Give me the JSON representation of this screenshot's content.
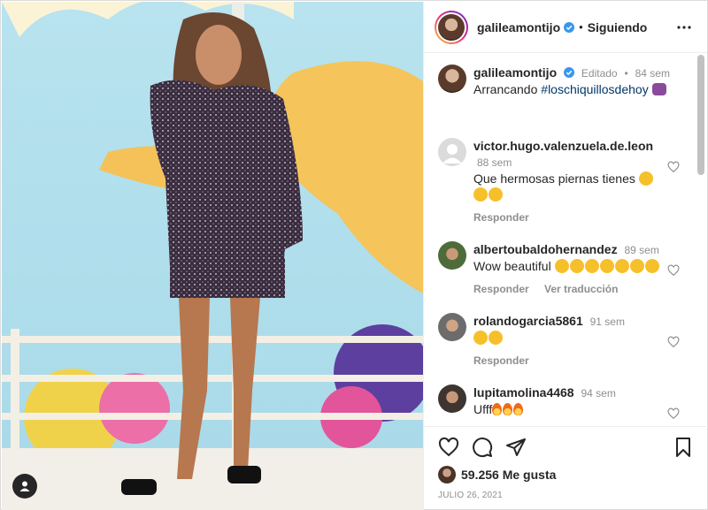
{
  "post": {
    "username": "galileamontijo",
    "separator": "•",
    "follow_status": "Siguiendo"
  },
  "caption": {
    "username": "galileamontijo",
    "edited": "Editado",
    "time": "84 sem",
    "text": "Arrancando",
    "hashtag": "#loschiquillosdehoy"
  },
  "comments": [
    {
      "username": "victor.hugo.valenzuela.de.leon",
      "time": "88 sem",
      "text": "Que hermosas piernas tienes",
      "emoji_count": 3,
      "actions": [
        "Responder"
      ]
    },
    {
      "username": "albertoubaldohernandez",
      "time": "89 sem",
      "text": "Wow beautiful",
      "emoji_count": 7,
      "actions": [
        "Responder",
        "Ver traducción"
      ]
    },
    {
      "username": "rolandogarcia5861",
      "time": "91 sem",
      "text": "",
      "emoji_count": 2,
      "actions": [
        "Responder"
      ]
    },
    {
      "username": "lupitamolina4468",
      "time": "94 sem",
      "text": "Ufff",
      "fire_count": 3,
      "actions": []
    }
  ],
  "likes": {
    "count": "59.256",
    "label": "Me gusta"
  },
  "date": "JULIO 26, 2021",
  "icons": [
    "heart-icon",
    "comment-icon",
    "share-icon",
    "bookmark-icon",
    "more-options-icon",
    "verified-icon",
    "user-tag-icon"
  ],
  "colors": {
    "link": "#00376b",
    "muted": "#8e8e8e",
    "text": "#262626",
    "verified": "#3897f0"
  }
}
